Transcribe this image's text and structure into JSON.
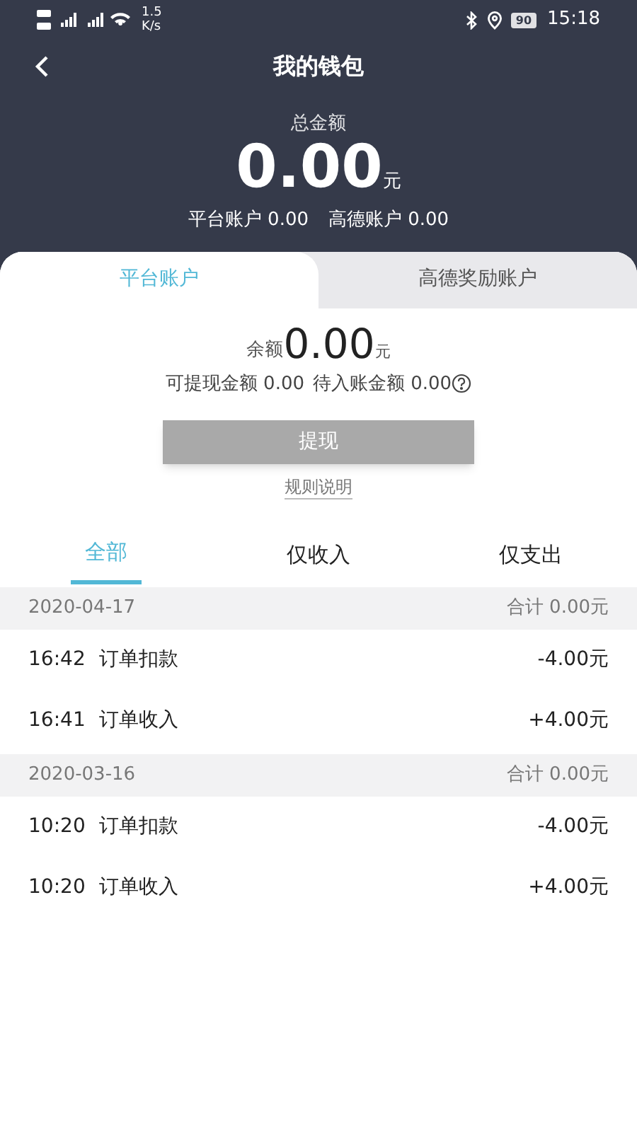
{
  "status_bar": {
    "speed": "1.5",
    "speed_unit": "K/s",
    "battery": "90",
    "time": "15:18"
  },
  "nav": {
    "title": "我的钱包"
  },
  "summary": {
    "label": "总金额",
    "amount": "0.00",
    "unit": "元",
    "accounts": [
      {
        "label": "平台账户",
        "value": "0.00"
      },
      {
        "label": "高德账户",
        "value": "0.00"
      }
    ]
  },
  "account_tabs": [
    {
      "label": "平台账户",
      "selected": true
    },
    {
      "label": "高德奖励账户",
      "selected": false
    }
  ],
  "balance": {
    "label": "余额",
    "amount": "0.00",
    "unit": "元",
    "withdrawable_label": "可提现金额",
    "withdrawable": "0.00",
    "pending_label": "待入账金额",
    "pending": "0.00"
  },
  "withdraw_button": {
    "label": "提现",
    "disabled": true
  },
  "rules_link": "规则说明",
  "filter_tabs": [
    {
      "label": "全部",
      "selected": true
    },
    {
      "label": "仅收入",
      "selected": false
    },
    {
      "label": "仅支出",
      "selected": false
    }
  ],
  "groups": [
    {
      "date": "2020-04-17",
      "total": "合计 0.00元",
      "items": [
        {
          "time": "16:42",
          "title": "订单扣款",
          "amount": "-4.00元"
        },
        {
          "time": "16:41",
          "title": "订单收入",
          "amount": "+4.00元"
        }
      ]
    },
    {
      "date": "2020-03-16",
      "total": "合计 0.00元",
      "items": [
        {
          "time": "10:20",
          "title": "订单扣款",
          "amount": "-4.00元"
        },
        {
          "time": "10:20",
          "title": "订单收入",
          "amount": "+4.00元"
        }
      ]
    }
  ]
}
